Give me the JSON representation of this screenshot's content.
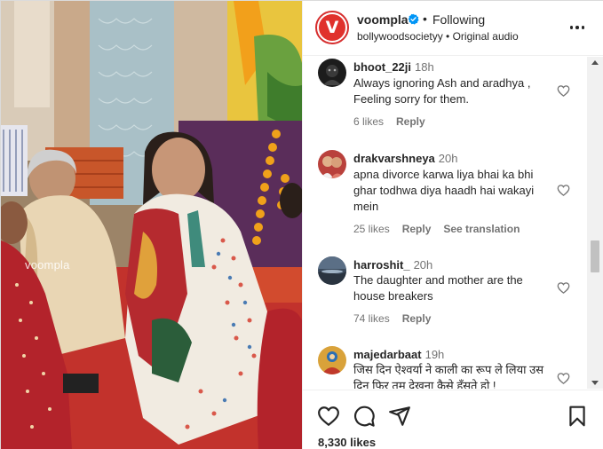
{
  "media": {
    "watermark": "voompla"
  },
  "header": {
    "avatar_letter": "V",
    "username": "voompla",
    "separator": "•",
    "follow_label": "Following",
    "subtitle": "bollywoodsocietyy • Original audio"
  },
  "comments": [
    {
      "username": "bhoot_22ji",
      "time": "18h",
      "text": "Always ignoring Ash and aradhya , Feeling sorry for them.",
      "likes": "6 likes",
      "reply": "Reply",
      "translate": ""
    },
    {
      "username": "drakvarshneya",
      "time": "20h",
      "text": "apna divorce karwa liya bhai ka bhi ghar todhwa diya haadh hai wakayi mein",
      "likes": "25 likes",
      "reply": "Reply",
      "translate": "See translation"
    },
    {
      "username": "harroshit_",
      "time": "20h",
      "text": "The daughter and mother are the house breakers",
      "likes": "74 likes",
      "reply": "Reply",
      "translate": ""
    },
    {
      "username": "majedarbaat",
      "time": "19h",
      "text": "जिस दिन ऐश्वर्या ने काली का रूप ले लिया उस दिन फिर तुम देखना कैसे हँसते हो !",
      "likes": "",
      "reply": "",
      "translate": ""
    }
  ],
  "footer": {
    "likes": "8,330 likes"
  },
  "colors": {
    "brand_red": "#e0312c",
    "verified_blue": "#0095f6",
    "text_primary": "#262626",
    "text_secondary": "#737373"
  },
  "icons": {
    "like": "heart-icon",
    "comment": "comment-icon",
    "share": "share-icon",
    "save": "bookmark-icon",
    "more": "more-options-icon"
  }
}
